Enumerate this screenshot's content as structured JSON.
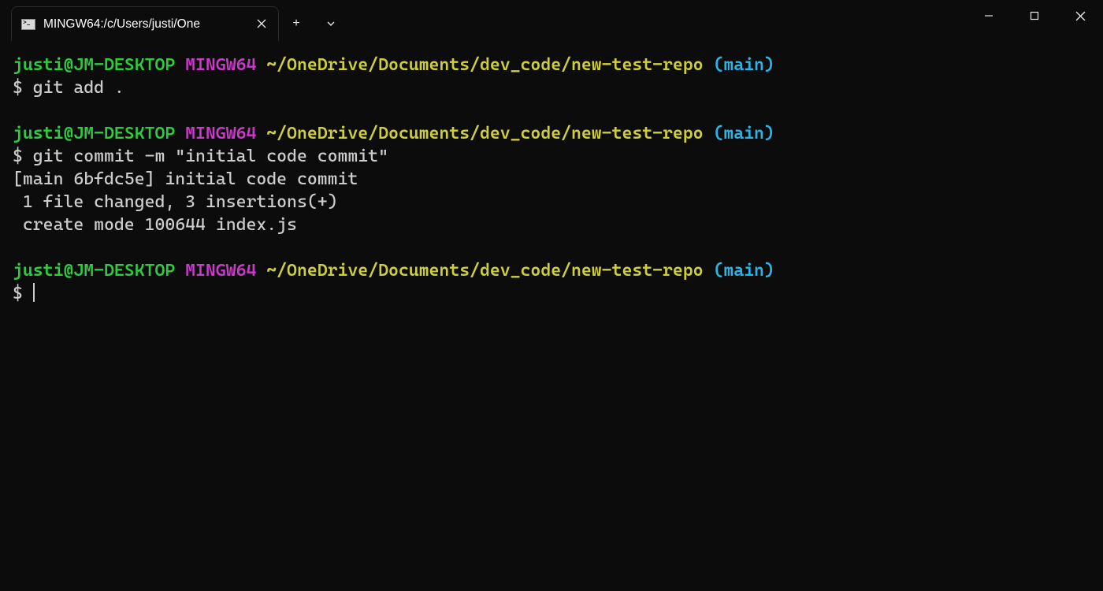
{
  "window": {
    "tab_title": "MINGW64:/c/Users/justi/One",
    "tab_icon_glyph": ">_",
    "new_tab_glyph": "+"
  },
  "prompt": {
    "user_host": "justi@JM-DESKTOP",
    "shell": "MINGW64",
    "path": "~/OneDrive/Documents/dev_code/new-test-repo",
    "branch_open": "(",
    "branch": "main",
    "branch_close": ")",
    "dollar": "$"
  },
  "blocks": [
    {
      "command": " git add .",
      "output": []
    },
    {
      "command": " git commit -m \"initial code commit\"",
      "output": [
        "[main 6bfdc5e] initial code commit",
        " 1 file changed, 3 insertions(+)",
        " create mode 100644 index.js"
      ]
    },
    {
      "command": " ",
      "output": []
    }
  ]
}
